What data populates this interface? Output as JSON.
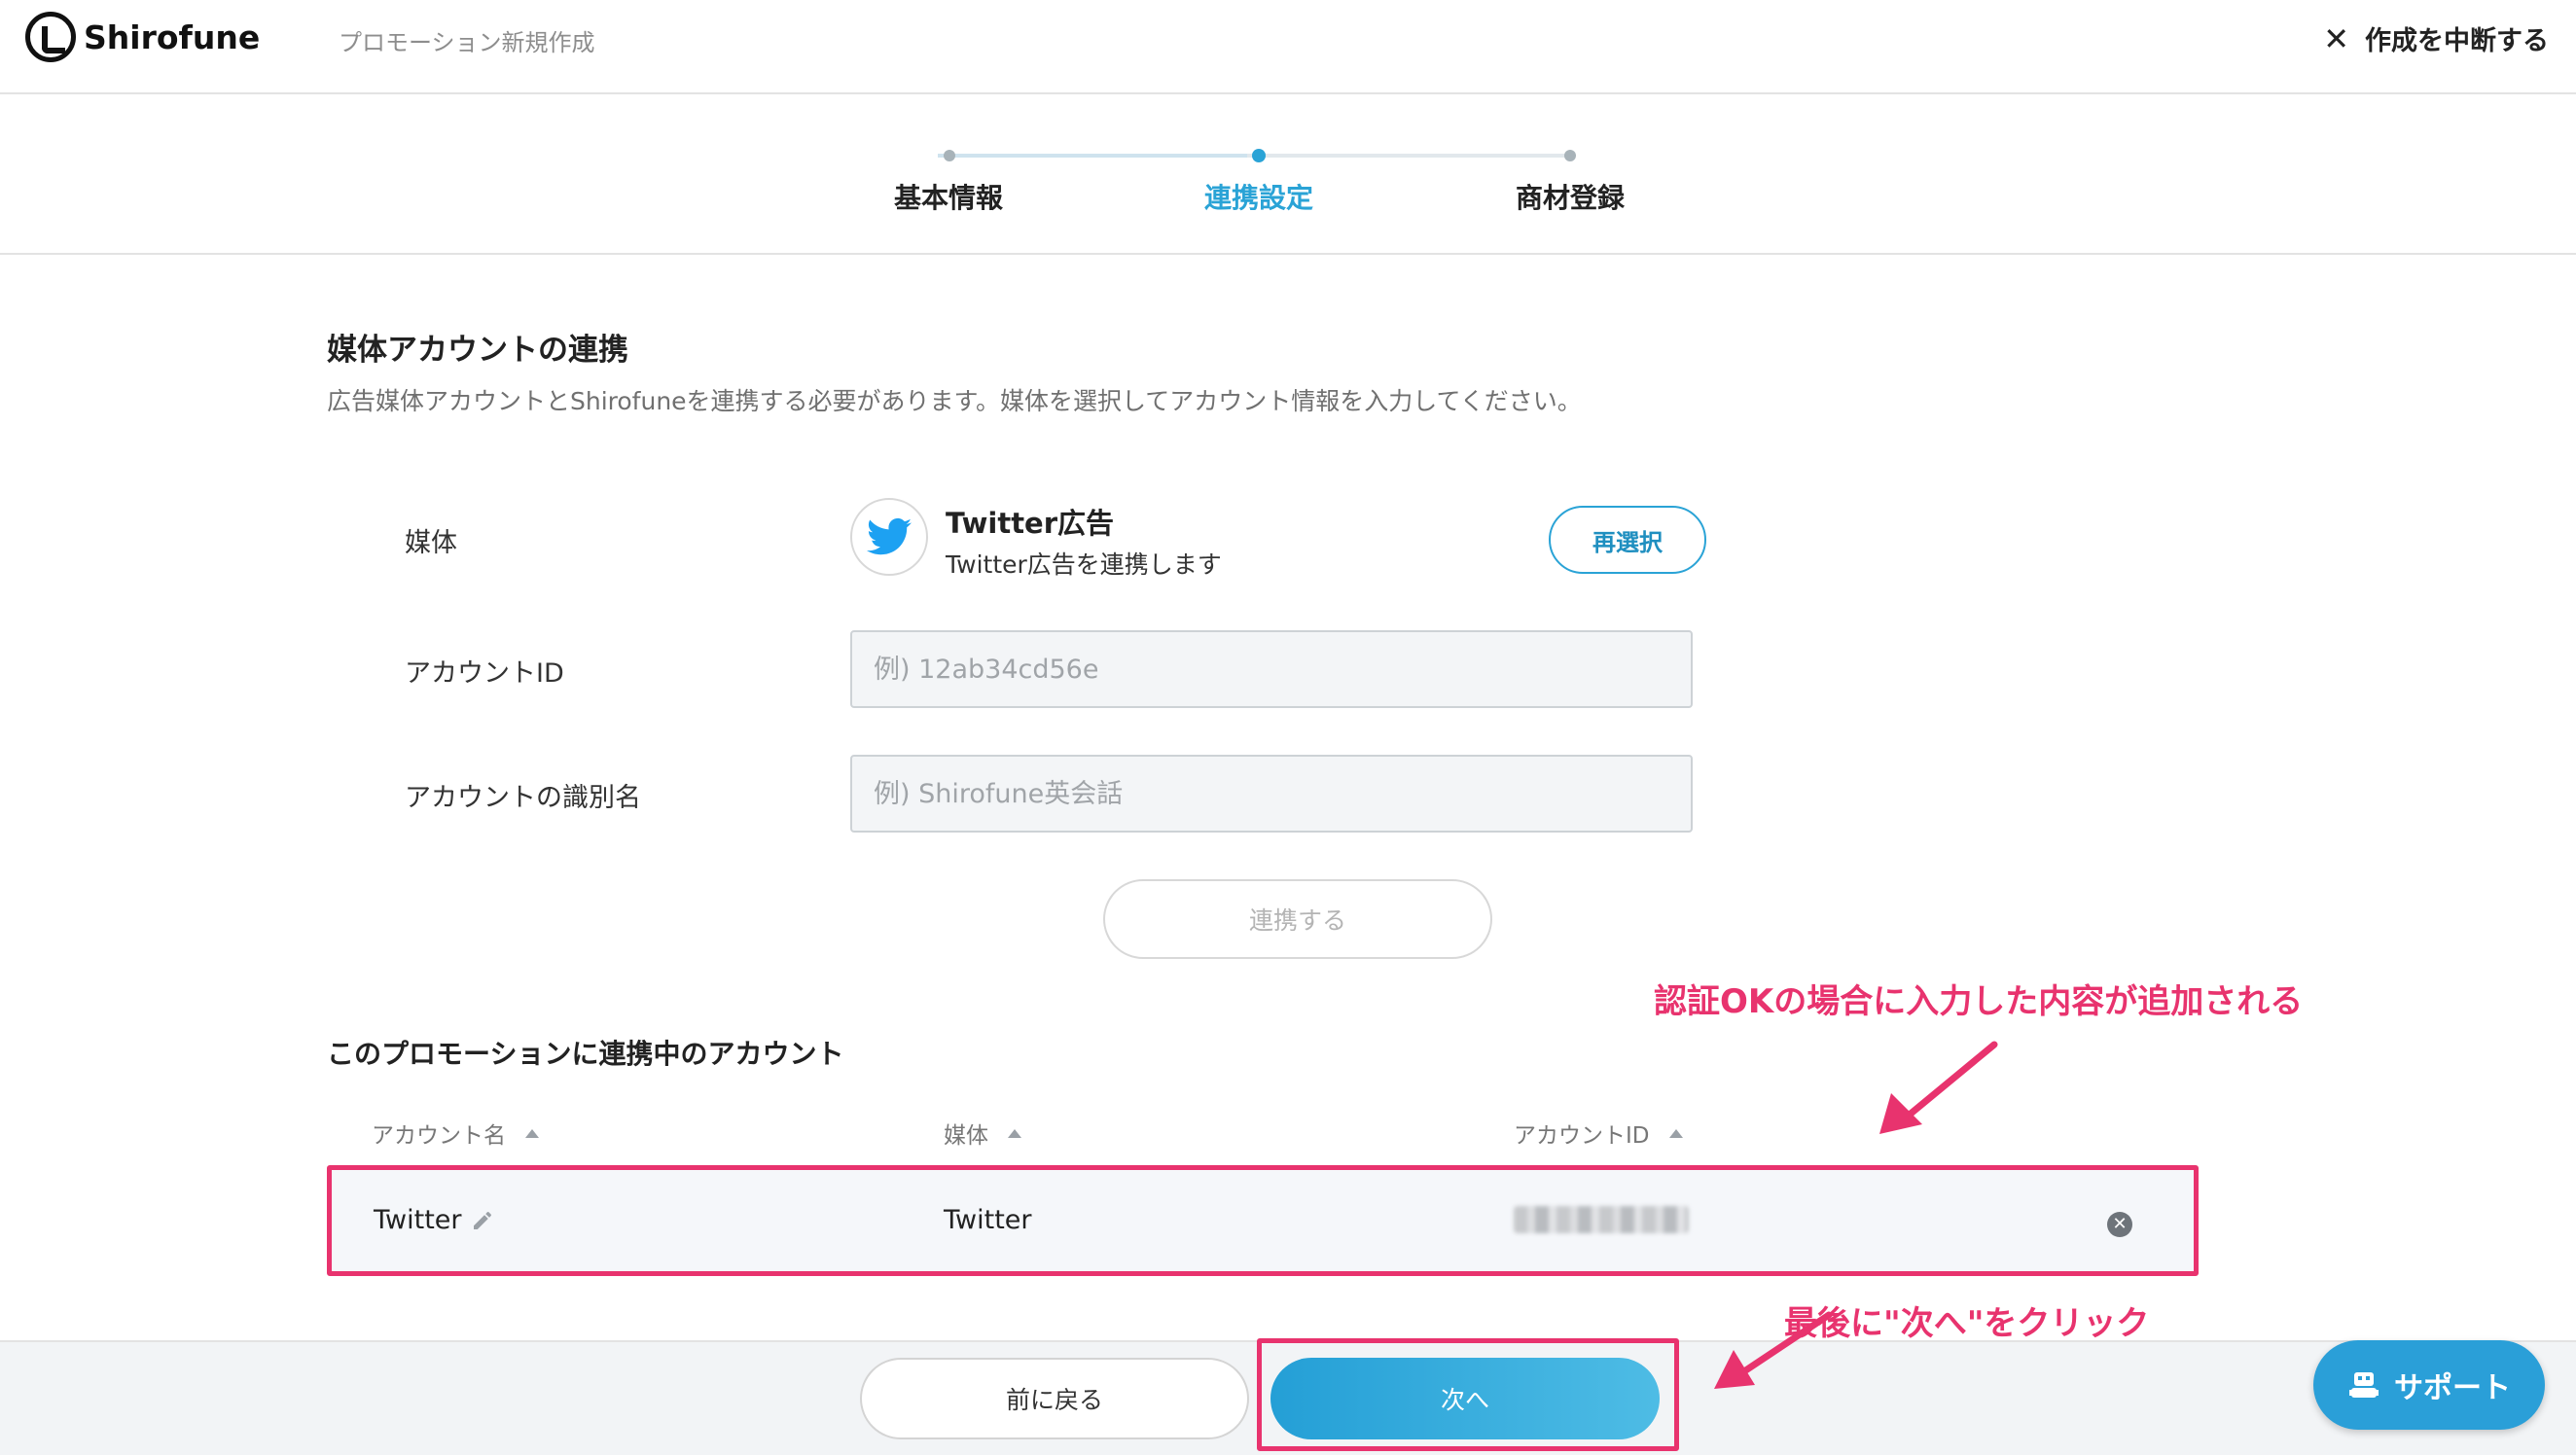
{
  "header": {
    "logo_text": "Shirofune",
    "title": "プロモーション新規作成",
    "abort_icon": "close-icon",
    "abort_label": "作成を中断する"
  },
  "stepper": {
    "steps": [
      {
        "label": "基本情報",
        "state": "done"
      },
      {
        "label": "連携設定",
        "state": "active"
      },
      {
        "label": "商材登録",
        "state": "pending"
      }
    ]
  },
  "section": {
    "title": "媒体アカウントの連携",
    "description": "広告媒体アカウントとShirofuneを連携する必要があります。媒体を選択してアカウント情報を入力してください。"
  },
  "form": {
    "media_label": "媒体",
    "media_icon": "twitter-bird-icon",
    "media_name": "Twitter広告",
    "media_sub": "Twitter広告を連携します",
    "reselect_label": "再選択",
    "account_id_label": "アカウントID",
    "account_id_placeholder": "例) 12ab34cd56e",
    "account_id_value": "",
    "account_name_label": "アカウントの識別名",
    "account_name_placeholder": "例) Shirofune英会話",
    "account_name_value": "",
    "link_button": "連携する"
  },
  "linked": {
    "title": "このプロモーションに連携中のアカウント",
    "headers": [
      "アカウント名",
      "媒体",
      "アカウントID"
    ],
    "rows": [
      {
        "name": "Twitter",
        "media": "Twitter",
        "account_id": ""
      }
    ]
  },
  "annotations": {
    "row_note": "認証OKの場合に入力した内容が追加される",
    "next_note": "最後に\"次へ\"をクリック",
    "color": "#e8336e"
  },
  "footer": {
    "back_label": "前に戻る",
    "next_label": "次へ",
    "support_label": "サポート"
  },
  "colors": {
    "accent": "#2aa3d6",
    "annotation": "#e8336e"
  }
}
